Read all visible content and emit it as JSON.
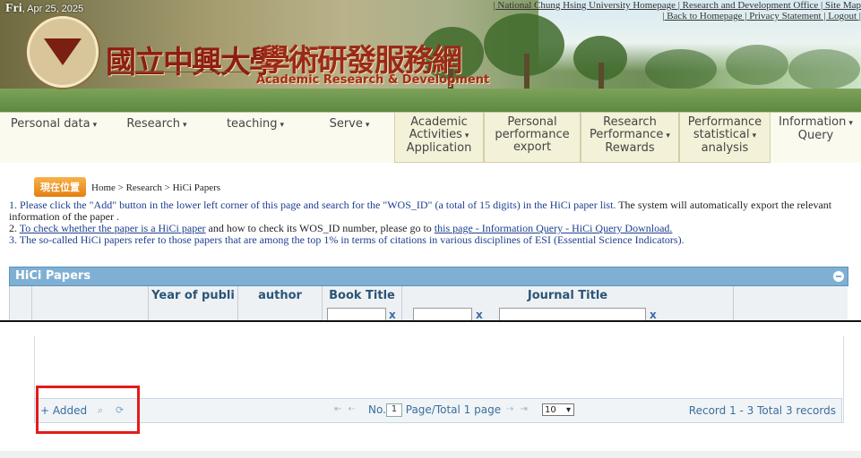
{
  "header": {
    "day": "Fri",
    "date": ", Apr 25, 2025",
    "top_links_line1": "| National Chung Hsing University Homepage | Research and Development Office | Site Map",
    "top_links_line2": "| Back to Homepage | Privacy Statement | Logout |",
    "title_cn_university": "國立中興大學",
    "title_cn_system": "學術研發服務網",
    "title_en": "Academic Research & Development"
  },
  "menu": [
    {
      "label": "Personal data",
      "caret": "▾"
    },
    {
      "label": "Research",
      "caret": "▾"
    },
    {
      "label": "teaching",
      "caret": "▾"
    },
    {
      "label": "Serve",
      "caret": "▾"
    },
    {
      "label_lines": [
        "Academic",
        "Activities",
        "Application"
      ],
      "caret": "▾"
    },
    {
      "label_lines": [
        "Personal",
        "performance",
        "export"
      ]
    },
    {
      "label_lines": [
        "Research",
        "Performance",
        "Rewards"
      ],
      "caret": "▾"
    },
    {
      "label_lines": [
        "Performance",
        "statistical",
        "analysis"
      ],
      "caret": "▾"
    },
    {
      "label_lines": [
        "Information",
        "Query"
      ],
      "caret": "▾"
    }
  ],
  "breadcrumb": {
    "badge": "現在位置",
    "path": "Home > Research > HiCi Papers"
  },
  "notes": {
    "line1_a": "1. Please click the \"Add\" button in the lower left corner of this page and search for the \"WOS_ID\" (a total of 15 digits) in the HiCi paper list.",
    "line1_b": " The system will automatically export the relevant information of the paper .",
    "line2_link1": "To check whether the paper is a HiCi paper",
    "line2_mid": " and how to check its WOS_ID number, please go to ",
    "line2_link2": "this page - Information Query - HiCi Query Download.",
    "line2_prefix": "2. ",
    "line3": "3. The so-called HiCi papers refer to those papers that are among the top 1% in terms of citations in various disciplines of ESI (Essential Science Indicators)."
  },
  "grid": {
    "title": "HiCi Papers",
    "columns": [
      "",
      "",
      "Year of publi",
      "author",
      "Book Title",
      "Journal Title"
    ],
    "clear_glyph": "x"
  },
  "pager": {
    "added_label": "+ Added",
    "search_icon": "⌕",
    "refresh_icon": "⟳",
    "nav_first_prev": "⇤ ⇠",
    "no_label": "No.",
    "page_value": "1",
    "page_total": "Page/Total 1 page",
    "nav_next_last": "⇢ ⇥",
    "rows_value": "10",
    "rows_caret": "▾",
    "records": "Record 1 - 3 Total 3 records"
  },
  "colors": {
    "highlight_box": "#e31b1b",
    "grid_header": "#7fb0d4",
    "badge": "#e37f10"
  }
}
